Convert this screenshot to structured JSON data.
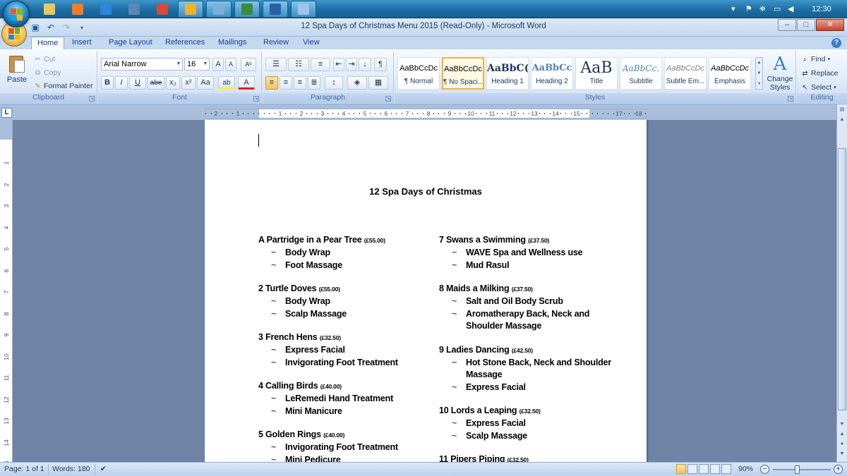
{
  "taskbar": {
    "clock": "12:30",
    "apps": [
      {
        "name": "file-explorer-icon",
        "color": "#e9c75c"
      },
      {
        "name": "media-player-icon",
        "color": "#f07b2a"
      },
      {
        "name": "internet-explorer-icon",
        "color": "#2b87d8"
      },
      {
        "name": "network-icon",
        "color": "#5c86b8"
      },
      {
        "name": "chrome-icon",
        "color": "#d64a3a"
      },
      {
        "name": "browser-icon",
        "color": "#f0b030"
      },
      {
        "name": "app-icon",
        "color": "#7ab0d8"
      },
      {
        "name": "excel-icon",
        "color": "#3c8a3c"
      },
      {
        "name": "word-icon",
        "color": "#2d5ea8"
      },
      {
        "name": "settings-icon",
        "color": "#9ec4e4"
      }
    ]
  },
  "window": {
    "title": "12 Spa Days of Christmas Menu 2015 (Read-Only)  -  Microsoft Word",
    "minimize": "–",
    "maximize": "□",
    "close": "✕"
  },
  "ribbon_tabs": [
    "Home",
    "Insert",
    "Page Layout",
    "References",
    "Mailings",
    "Review",
    "View"
  ],
  "clipboard": {
    "label": "Clipboard",
    "paste": "Paste",
    "cut": "Cut",
    "copy": "Copy",
    "format_painter": "Format Painter"
  },
  "font": {
    "label": "Font",
    "font_name": "Arial Narrow",
    "font_size": "16",
    "grow": "A",
    "shrink": "A",
    "clear": "Aᵇ",
    "bold": "B",
    "italic": "I",
    "underline": "U",
    "strike": "abe",
    "subscript": "x₂",
    "superscript": "x²",
    "change_case": "Aa",
    "highlight": "ab",
    "font_color": "A"
  },
  "paragraph": {
    "label": "Paragraph"
  },
  "styles": {
    "label": "Styles",
    "gallery": [
      {
        "sample": "AaBbCcDc",
        "name": "¶ Normal"
      },
      {
        "sample": "AaBbCcDc",
        "name": "¶ No Spaci..."
      },
      {
        "sample": "AaBbC(",
        "name": "Heading 1"
      },
      {
        "sample": "AaBbCc",
        "name": "Heading 2"
      },
      {
        "sample": "AaB",
        "name": "Title"
      },
      {
        "sample": "AaBbCc.",
        "name": "Subtitle"
      },
      {
        "sample": "AaBbCcDc",
        "name": "Subtle Em..."
      },
      {
        "sample": "AaBbCcDc",
        "name": "Emphasis"
      }
    ],
    "change_styles": "Change Styles"
  },
  "editing": {
    "label": "Editing",
    "find": "Find",
    "replace": "Replace",
    "select": "Select"
  },
  "ruler": {
    "ticks": [
      "2",
      "1",
      "1",
      "2",
      "3",
      "4",
      "5",
      "6",
      "7",
      "8",
      "9",
      "10",
      "11",
      "12",
      "13",
      "14",
      "15",
      "17",
      "18"
    ],
    "vticks": [
      "1",
      "2",
      "3",
      "4",
      "5",
      "6",
      "7",
      "8",
      "9",
      "10",
      "11",
      "12",
      "13",
      "14",
      "15"
    ],
    "corner": "L"
  },
  "document": {
    "title": "12 Spa Days of Christmas",
    "left_column": [
      {
        "name": "A Partridge in a Pear Tree",
        "price": "(£55.00)",
        "items": [
          "Body Wrap",
          "Foot Massage"
        ]
      },
      {
        "name": "2 Turtle Doves",
        "price": "(£55.00)",
        "items": [
          "Body Wrap",
          "Scalp Massage"
        ]
      },
      {
        "name": "3 French Hens",
        "price": "(£32.50)",
        "items": [
          "Express Facial",
          "Invigorating Foot Treatment"
        ]
      },
      {
        "name": "4 Calling Birds",
        "price": "(£40.00)",
        "items": [
          "LeRemedi Hand Treatment",
          "Mini Manicure"
        ]
      },
      {
        "name": "5 Golden Rings",
        "price": "(£40.00)",
        "items": [
          "Invigorating Foot Treatment",
          "Mini Pedicure"
        ]
      }
    ],
    "right_column": [
      {
        "name": "7 Swans a Swimming",
        "price": "(£37.50)",
        "items": [
          "WAVE Spa and Wellness use",
          "Mud Rasul"
        ]
      },
      {
        "name": "8 Maids a Milking",
        "price": "(£37.50)",
        "items": [
          "Salt and Oil Body Scrub",
          "Aromatherapy Back, Neck and Shoulder Massage"
        ]
      },
      {
        "name": "9 Ladies Dancing",
        "price": "(£42.50)",
        "items": [
          "Hot Stone Back, Neck and Shoulder Massage",
          "Express Facial"
        ]
      },
      {
        "name": "10 Lords a Leaping",
        "price": "(£32.50)",
        "items": [
          "Express Facial",
          "Scalp Massage"
        ]
      },
      {
        "name": "11 Pipers Piping",
        "price": "(£32.50)",
        "items": []
      }
    ],
    "bullet": "~"
  },
  "status": {
    "page": "Page: 1 of 1",
    "words": "Words: 180",
    "zoom": "90%"
  }
}
